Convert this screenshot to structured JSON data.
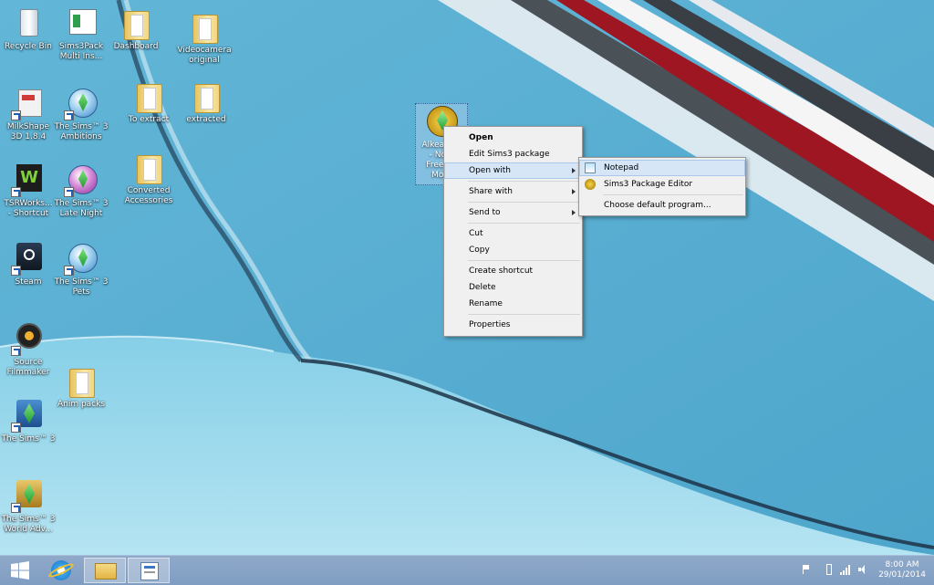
{
  "desktop": {
    "icons": [
      {
        "label": "Recycle Bin"
      },
      {
        "label": "Sims3Pack\nMulti Ins..."
      },
      {
        "label": "Dashboard"
      },
      {
        "label": "Videocamera\noriginal"
      },
      {
        "label": "MilkShape\n3D 1.8.4"
      },
      {
        "label": "The Sims™ 3\nAmbitions"
      },
      {
        "label": "To extract"
      },
      {
        "label": "extracted"
      },
      {
        "label": "TSRWorks...\n- Shortcut"
      },
      {
        "label": "The Sims™ 3\nLate Night"
      },
      {
        "label": "Converted\nAccessories"
      },
      {
        "label": "Steam"
      },
      {
        "label": "The Sims™ 3\nPets"
      },
      {
        "label": "Source\nFilmmaker"
      },
      {
        "label": "Anim packs"
      },
      {
        "label": "The Sims™ 3"
      },
      {
        "label": "The Sims™ 3\nWorld Adv..."
      }
    ],
    "selected_file_label": "Alkea G...\n- No...\nFreed...\nMo..."
  },
  "context_menu": {
    "items": [
      {
        "label": "Open"
      },
      {
        "label": "Edit Sims3 package"
      },
      {
        "label": "Open with"
      },
      {
        "label": "Share with"
      },
      {
        "label": "Send to"
      },
      {
        "label": "Cut"
      },
      {
        "label": "Copy"
      },
      {
        "label": "Create shortcut"
      },
      {
        "label": "Delete"
      },
      {
        "label": "Rename"
      },
      {
        "label": "Properties"
      }
    ]
  },
  "open_with_submenu": {
    "items": [
      {
        "label": "Notepad"
      },
      {
        "label": "Sims3 Package Editor"
      },
      {
        "label": "Choose default program..."
      }
    ]
  },
  "taskbar": {
    "start_icon": "windows-logo-icon",
    "pinned": [
      "internet-explorer-icon",
      "file-explorer-icon",
      "document-app-icon"
    ],
    "tray": {
      "time": "8:00 AM",
      "date": "29/01/2014"
    }
  },
  "colors": {
    "menu_hover": "#d6e6f7",
    "taskbar": "#8fa9c9"
  }
}
